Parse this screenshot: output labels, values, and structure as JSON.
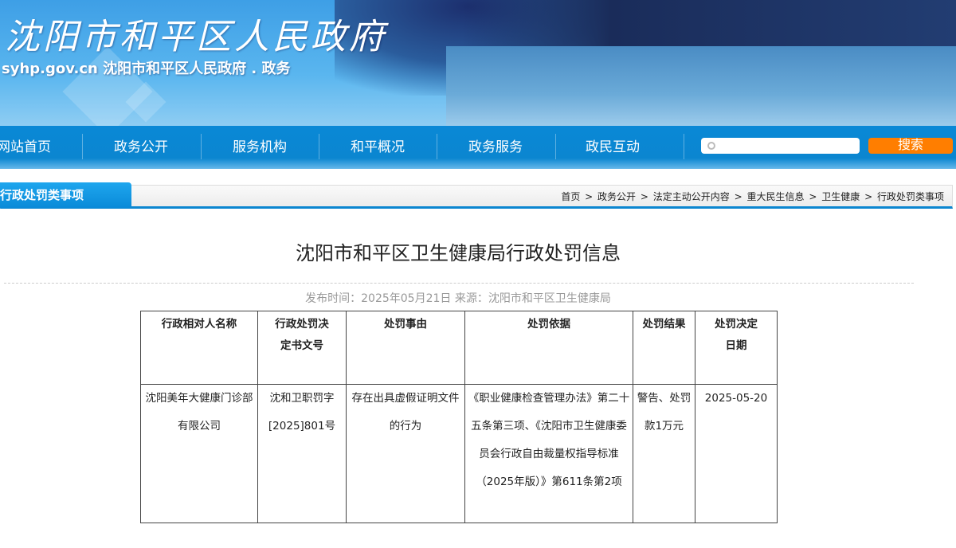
{
  "header": {
    "logo": "沈阳市和平区人民政府",
    "subtitle": "syhp.gov.cn  沈阳市和平区人民政府 . 政务"
  },
  "nav": [
    "网站首页",
    "政务公开",
    "服务机构",
    "和平概况",
    "政务服务",
    "政民互动"
  ],
  "search": {
    "placeholder": "",
    "button": "搜索"
  },
  "section": {
    "title": "行政处罚类事项",
    "breadcrumb": [
      "首页",
      "政务公开",
      "法定主动公开内容",
      "重大民生信息",
      "卫生健康",
      "行政处罚类事项"
    ],
    "sep": ">"
  },
  "article": {
    "title": "沈阳市和平区卫生健康局行政处罚信息",
    "meta": "发布时间：2025年05月21日 来源：沈阳市和平区卫生健康局"
  },
  "table": {
    "headers": [
      "行政相对人名称",
      "行政处罚决定书文号",
      "处罚事由",
      "处罚依据",
      "处罚结果",
      "处罚决定日期"
    ],
    "rows": [
      [
        "沈阳美年大健康门诊部有限公司",
        "沈和卫职罚字[2025]801号",
        "存在出具虚假证明文件的行为",
        "《职业健康检查管理办法》第二十五条第三项、《沈阳市卫生健康委员会行政自由裁量权指导标准（2025年版）》第611条第2项",
        "警告、处罚款1万元",
        "2025-05-20"
      ]
    ]
  }
}
